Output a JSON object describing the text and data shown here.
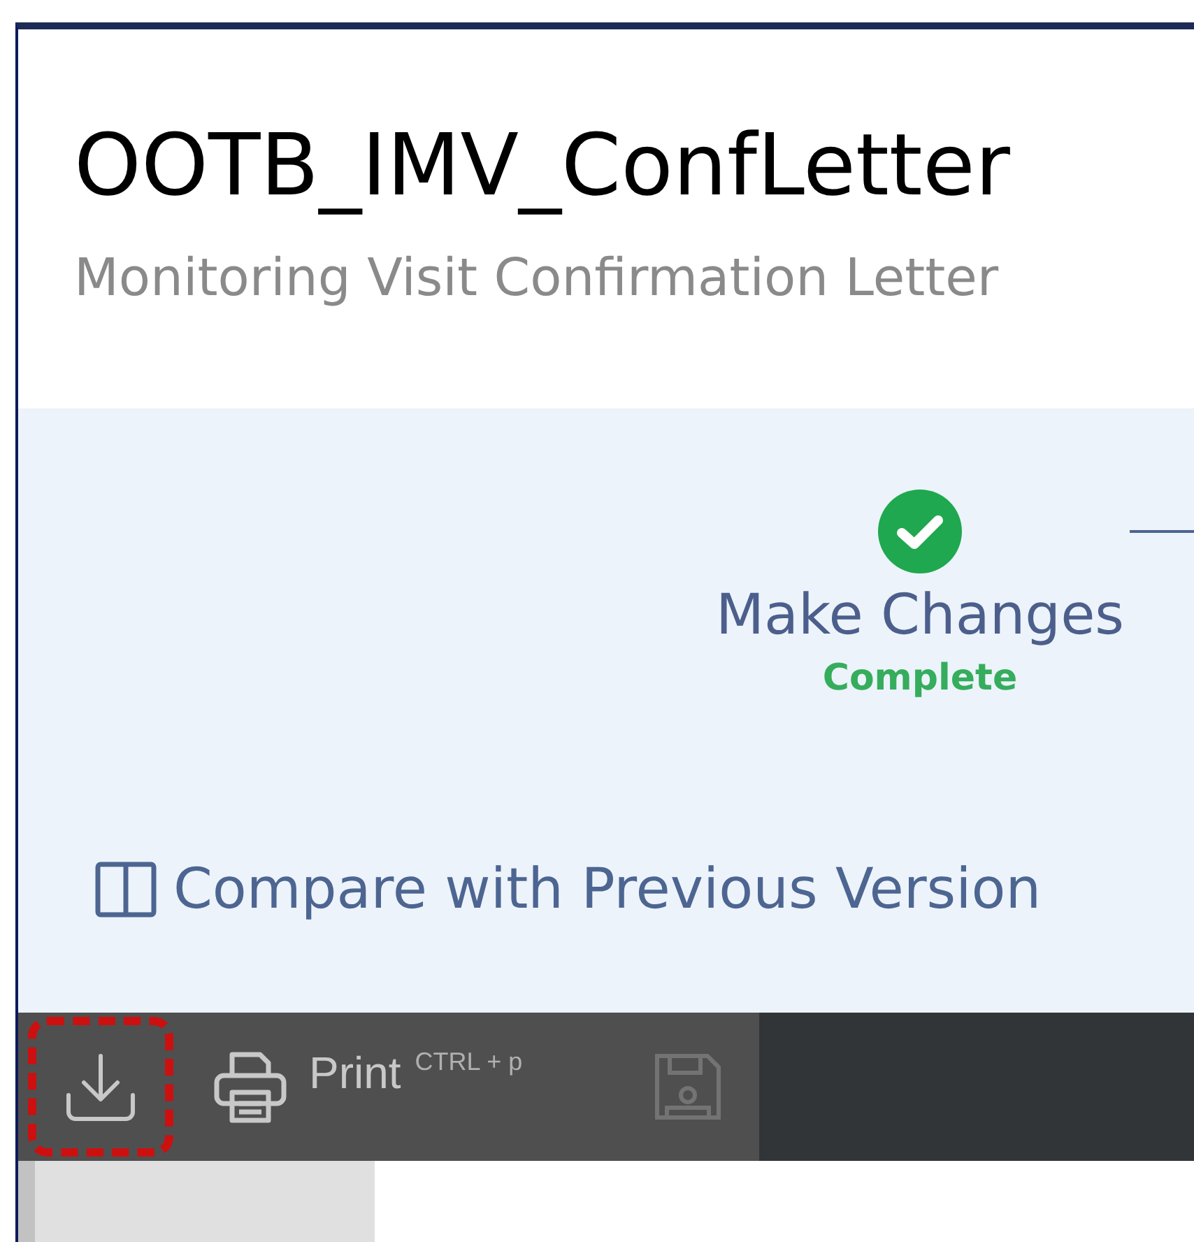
{
  "document": {
    "title": "OOTB_IMV_ConfLetter",
    "subtitle": "Monitoring Visit Confirmation Letter"
  },
  "steps": [
    {
      "label": "Make Changes",
      "status": "Complete",
      "completed": true
    }
  ],
  "compare_button": {
    "label": "Compare with Previous Version"
  },
  "toolbar": [
    {
      "kind": "download",
      "highlighted": true,
      "disabled": false
    },
    {
      "kind": "print",
      "label": "Print",
      "shortcut": "CTRL + p",
      "highlighted": false,
      "disabled": false
    },
    {
      "kind": "save",
      "highlighted": false,
      "disabled": true
    }
  ]
}
